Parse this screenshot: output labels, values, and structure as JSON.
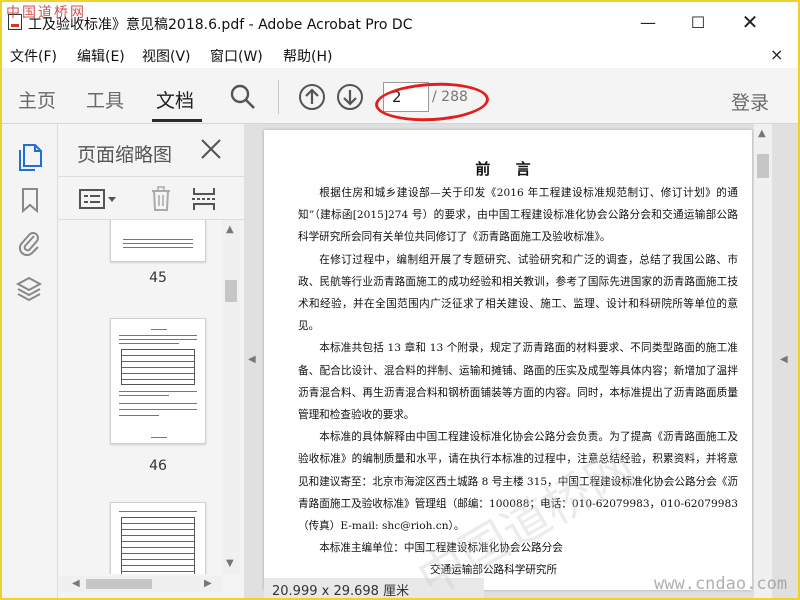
{
  "window": {
    "title": "工及验收标准》意见稿2018.6.pdf - Adobe Acrobat Pro DC",
    "minimize": "—",
    "maximize": "☐",
    "close": "✕"
  },
  "watermark": {
    "logo": "中国道桥网",
    "url": "www.cndao.com"
  },
  "menu": {
    "items": [
      "文件(F)",
      "编辑(E)",
      "视图(V)",
      "窗口(W)",
      "帮助(H)"
    ],
    "close": "×"
  },
  "toolbar": {
    "tabs": [
      "主页",
      "工具",
      "文档"
    ],
    "active_tab": "文档",
    "page_current": "2",
    "page_total": "/ 288",
    "login": "登录",
    "annotation_color": "#e02020"
  },
  "thumbnails": {
    "title": "页面缩略图",
    "close": "✕",
    "pages": [
      "45",
      "46"
    ]
  },
  "document": {
    "title": "前 言",
    "paragraphs": [
      "根据住房和城乡建设部—关于印发《2016 年工程建设标准规范制订、修订计划》的通知”（建标函[2015]274 号）的要求，由中国工程建设标准化协会公路分会和交通运输部公路科学研究所会同有关单位共同修订了《沥青路面施工及验收标准》。",
      "在修订过程中，编制组开展了专题研究、试验研究和广泛的调查，总结了我国公路、市政、民航等行业沥青路面施工的成功经验和相关教训，参考了国际先进国家的沥青路面施工技术和经验，并在全国范围内广泛征求了相关建设、施工、监理、设计和科研院所等单位的意见。",
      "本标准共包括 13 章和 13 个附录，规定了沥青路面的材料要求、不同类型路面的施工准备、配合比设计、混合料的拌制、运输和摊铺、路面的压实及成型等具体内容；新增加了温拌沥青混合料、再生沥青混合料和钢桥面铺装等方面的内容。同时，本标准提出了沥青路面质量管理和检查验收的要求。",
      "本标准的具体解释由中国工程建设标准化协会公路分会负责。为了提高《沥青路面施工及验收标准》的编制质量和水平，请在执行本标准的过程中，注意总结经验，积累资料，并将意见和建议寄至：北京市海淀区西土城路 8 号主楼 315，中国工程建设标准化协会公路分会《沥青路面施工及验收标准》管理组（邮编：100088；电话：010-62079983，010-62079983（传真）E-mail: shc@rioh.cn）。",
      "本标准主编单位：中国工程建设标准化协会公路分会"
    ],
    "org_line": "交通运输部公路科学研究所",
    "status": "20.999 x 29.698 厘米"
  }
}
